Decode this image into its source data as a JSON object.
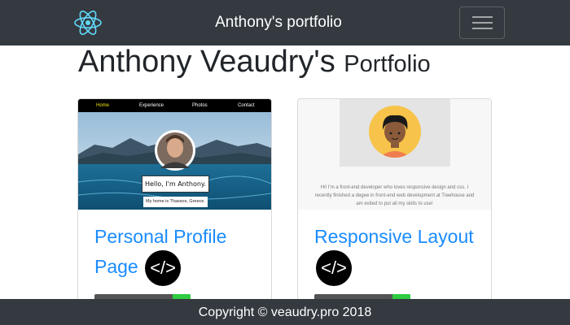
{
  "navbar": {
    "title": "Anthony's portfolio",
    "logo_icon": "react-atom-icon",
    "menu_icon": "hamburger-menu-icon",
    "background": "#343a40"
  },
  "heading": {
    "main": "Anthony Veaudry's",
    "sub": "Portfolio"
  },
  "cards": [
    {
      "title": "Personal Profile Page",
      "badge": "</>",
      "thumbnail": {
        "nav_items": [
          "Home",
          "Experience",
          "Photos",
          "Contact"
        ],
        "active_item": "Home",
        "greeting": "Hello, I'm Anthony.",
        "caption": "My home is Thassos, Greece."
      }
    },
    {
      "title": "Responsive Layout",
      "badge": "</>",
      "thumbnail": {
        "bio": "Hi! I'm a front-end developer who loves responsive design and css. I recently finished a degee in front-end web development at Treehouse and am exited to put all my skills to use!"
      }
    }
  ],
  "footer": {
    "text": "Copyright © veaudry.pro 2018"
  },
  "colors": {
    "accent": "#1a8cff",
    "dark": "#343a40",
    "highlight": "#f2e600"
  }
}
